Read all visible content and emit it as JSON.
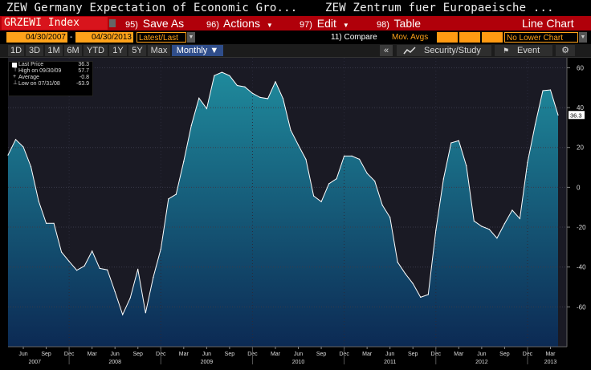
{
  "header": {
    "title_left": "ZEW Germany Expectation of Economic Gro...",
    "title_right": "ZEW Zentrum fuer Europaeische ..."
  },
  "toolbar": {
    "ticker": "GRZEWI Index",
    "save_num": "95)",
    "save_label": "Save As",
    "actions_num": "96)",
    "actions_label": "Actions",
    "edit_num": "97)",
    "edit_label": "Edit",
    "table_num": "98)",
    "table_label": "Table",
    "chart_type": "Line Chart"
  },
  "datebar": {
    "start_date": "04/30/2007",
    "end_date": "04/30/2013",
    "range_mode": "Latest/Last",
    "compare_num": "11)",
    "compare_label": "Compare",
    "mov_avgs_label": "Mov. Avgs",
    "lower_chart": "No Lower Chart"
  },
  "tabs": {
    "items": [
      "1D",
      "3D",
      "1M",
      "6M",
      "YTD",
      "1Y",
      "5Y",
      "Max",
      "Monthly ▼"
    ],
    "active_index": 8,
    "collapse_icon": "«",
    "security_study": "Security/Study",
    "event": "Event",
    "gear": "⚙"
  },
  "legend": {
    "last_price_label": "Last Price",
    "last_price_value": "36.3",
    "high_label": "High on 09/30/09",
    "high_value": "57.7",
    "average_label": "Average",
    "average_value": "-0.8",
    "low_label": "Low on 07/31/08",
    "low_value": "-63.9"
  },
  "colors": {
    "red_bar": "#b0000a",
    "orange": "#ffa21a",
    "area_top": "#1f8a9c",
    "area_bottom": "#0c2a54",
    "line": "#ffffff",
    "last_label_bg": "#ffffff"
  },
  "chart_data": {
    "type": "area",
    "title": "",
    "ylim": [
      -80,
      65
    ],
    "yticks": [
      60,
      40,
      20,
      0,
      -20,
      -40,
      -60
    ],
    "last_value_label": "36.3",
    "x_month_labels": [
      "Jun",
      "Sep",
      "Dec",
      "Mar",
      "Jun",
      "Sep",
      "Dec",
      "Mar",
      "Jun",
      "Sep",
      "Dec",
      "Mar",
      "Jun",
      "Sep",
      "Dec",
      "Mar",
      "Jun",
      "Sep",
      "Dec",
      "Mar",
      "Jun",
      "Sep",
      "Dec",
      "Mar"
    ],
    "x_year_labels": [
      "2007",
      "2008",
      "2009",
      "2010",
      "2011",
      "2012",
      "2013"
    ],
    "x_start": "2007-04",
    "series": [
      {
        "values": [
          16.2,
          24,
          20.3,
          10.4,
          -6.9,
          -18.1,
          -18.1,
          -32.5,
          -37.2,
          -41.6,
          -39.5,
          -32,
          -40.7,
          -41.4,
          -52.4,
          -63.9,
          -55.5,
          -41.1,
          -63,
          -45.2,
          -31,
          -5.8,
          -3.5,
          13,
          31.1,
          44.8,
          39.5,
          56.1,
          57.7,
          56,
          51.1,
          50.4,
          47.2,
          45.1,
          44.5,
          53,
          44.5,
          28.7,
          21.2,
          14,
          -4.3,
          -7.2,
          1.8,
          4.3,
          15.7,
          15.7,
          14.1,
          7,
          3.1,
          -9,
          -15.1,
          -37.6,
          -43.3,
          -48.3,
          -55.2,
          -53.8,
          -21.6,
          4.2,
          22.3,
          23.4,
          10.8,
          -16.9,
          -19.6,
          -21.1,
          -25.5,
          -18.2,
          -11.5,
          -15.7,
          12.4,
          31.5,
          48.5,
          48.9,
          36.3
        ]
      }
    ]
  }
}
